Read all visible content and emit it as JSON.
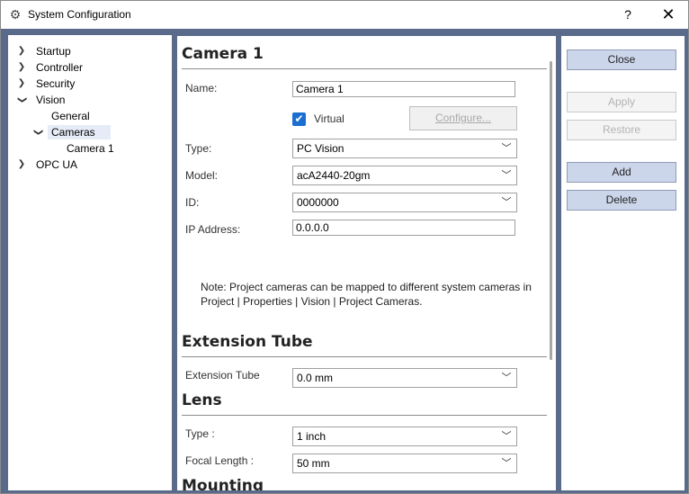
{
  "window": {
    "title": "System Configuration",
    "help_label": "?",
    "close_label": "✕"
  },
  "tree": {
    "items": [
      {
        "label": "Startup",
        "expanded": false
      },
      {
        "label": "Controller",
        "expanded": false
      },
      {
        "label": "Security",
        "expanded": false
      },
      {
        "label": "Vision",
        "expanded": true
      },
      {
        "label": "General"
      },
      {
        "label": "Cameras",
        "expanded": true
      },
      {
        "label": "Camera 1"
      },
      {
        "label": "OPC UA",
        "expanded": false
      }
    ]
  },
  "camera": {
    "title": "Camera 1",
    "name_label": "Name:",
    "name_value": "Camera 1",
    "virtual_label": "Virtual",
    "virtual_checked": true,
    "configure_label": "Configure...",
    "type_label": "Type:",
    "type_value": "PC Vision",
    "model_label": "Model:",
    "model_value": "acA2440-20gm",
    "id_label": "ID:",
    "id_value": "0000000",
    "ip_label": "IP Address:",
    "ip_value": "0.0.0.0",
    "note_line1": "Note: Project cameras can be mapped to different system cameras in",
    "note_line2": "Project | Properties | Vision | Project Cameras."
  },
  "extension_tube": {
    "title": "Extension Tube",
    "label": "Extension Tube",
    "value": "0.0 mm"
  },
  "lens": {
    "title": "Lens",
    "type_label": "Type :",
    "type_value": "1 inch",
    "focal_label": "Focal Length :",
    "focal_value": "50 mm"
  },
  "mounting": {
    "title": "Mounting"
  },
  "buttons": {
    "close": "Close",
    "apply": "Apply",
    "restore": "Restore",
    "add": "Add",
    "delete": "Delete"
  },
  "icons": {
    "app": "gear-icon",
    "expand": "chevron-down-icon",
    "collapse": "chevron-right-icon",
    "dropdown": "chevron-down-icon",
    "check": "checkmark-icon"
  },
  "colors": {
    "accent": "#1b6fd1",
    "button_bg": "#ccd6ea",
    "frame": "#5a6a8a"
  }
}
